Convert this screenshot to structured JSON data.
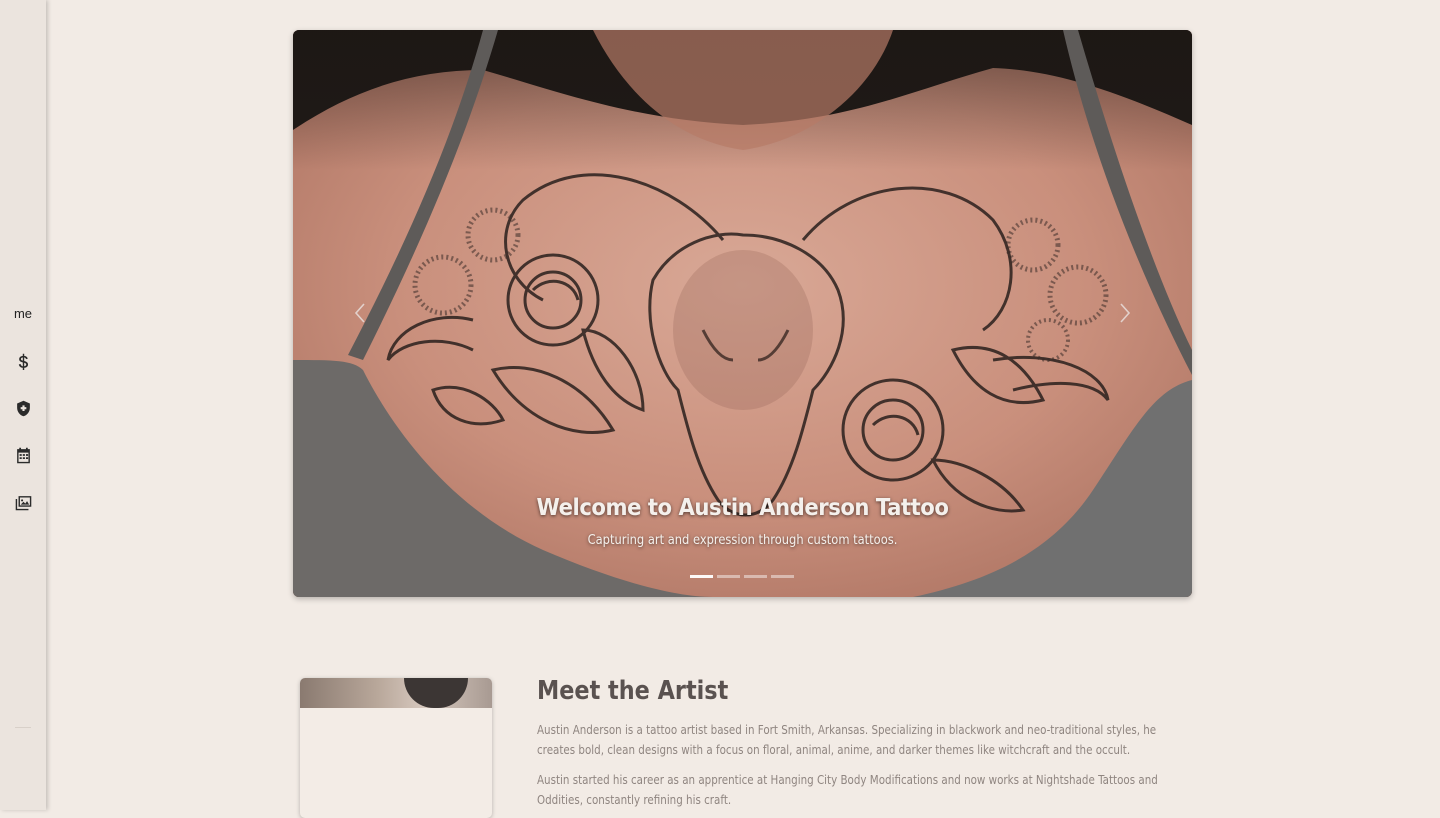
{
  "sidebar": {
    "home_label": "me",
    "items": [
      {
        "icon": "dollar-icon"
      },
      {
        "icon": "shield-plus-icon"
      },
      {
        "icon": "calendar-icon"
      },
      {
        "icon": "images-icon"
      }
    ]
  },
  "hero": {
    "title": "Welcome to Austin Anderson Tattoo",
    "subtitle": "Capturing art and expression through custom tattoos.",
    "slide_count": 4,
    "active_slide": 1
  },
  "artist": {
    "heading": "Meet the Artist",
    "paragraphs": [
      "Austin Anderson is a tattoo artist based in Fort Smith, Arkansas. Specializing in blackwork and neo-traditional styles, he creates bold, clean designs with a focus on floral, animal, anime, and darker themes like witchcraft and the occult.",
      "Austin started his career as an apprentice at Hanging City Body Modifications and now works at Nightshade Tattoos and Oddities, constantly refining his craft."
    ]
  },
  "colors": {
    "page_bg": "#f2ebe5",
    "sidebar_bg": "#ebe4de",
    "heading": "#5a5250",
    "body_text": "#8f8580"
  }
}
